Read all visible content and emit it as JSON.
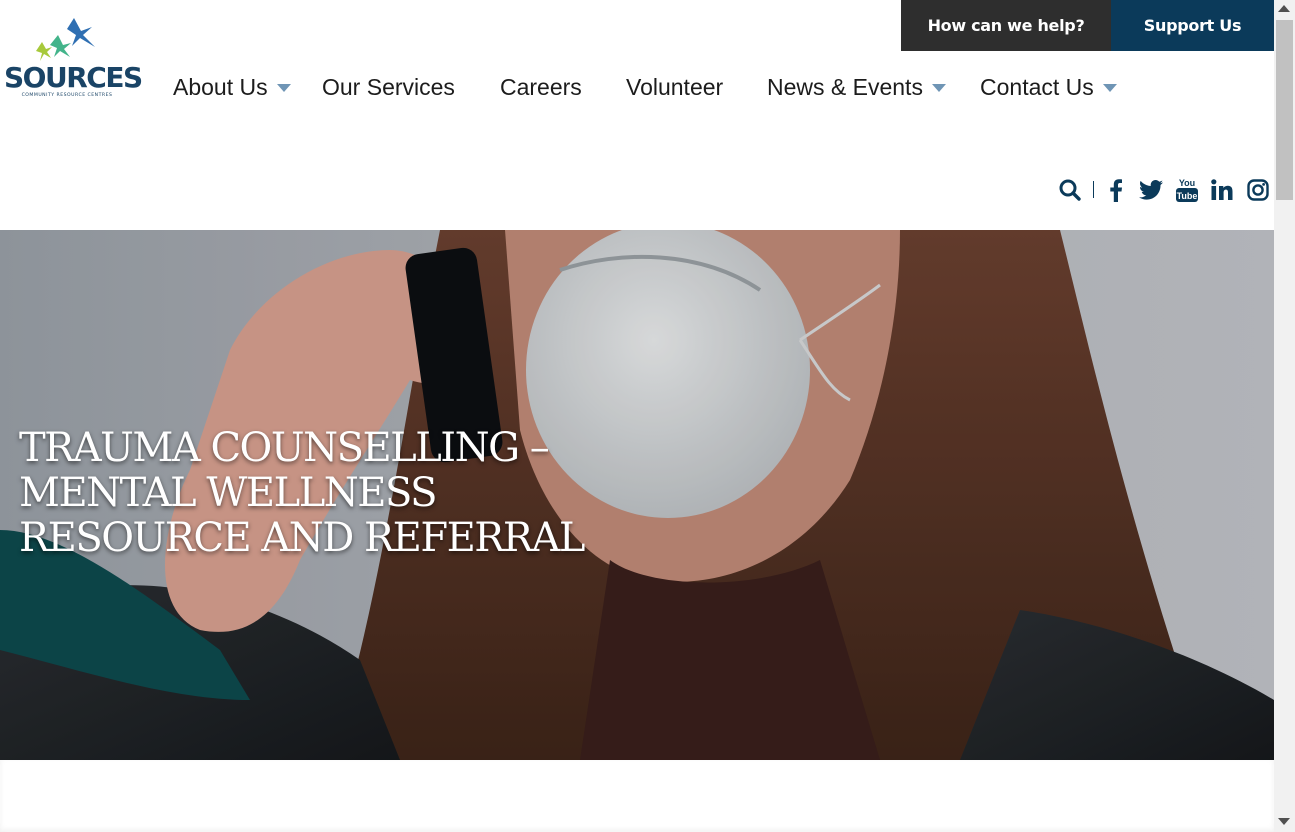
{
  "header": {
    "help_button": "How can we help?",
    "support_button": "Support Us"
  },
  "logo": {
    "wordmark": "SOURCES",
    "tagline": "COMMUNITY RESOURCE CENTRES"
  },
  "nav": {
    "items": [
      {
        "label": "About Us",
        "has_dropdown": true
      },
      {
        "label": "Our Services",
        "has_dropdown": false
      },
      {
        "label": "Careers",
        "has_dropdown": false
      },
      {
        "label": "Volunteer",
        "has_dropdown": false
      },
      {
        "label": "News & Events",
        "has_dropdown": true
      },
      {
        "label": "Contact Us",
        "has_dropdown": true
      }
    ]
  },
  "social_icons": [
    "search-icon",
    "facebook-icon",
    "twitter-icon",
    "youtube-icon",
    "linkedin-icon",
    "instagram-icon"
  ],
  "hero": {
    "title": "TRAUMA COUNSELLING – MENTAL WELLNESS RESOURCE AND REFERRAL",
    "image_subject": "person in face mask on phone"
  },
  "colors": {
    "brand_navy": "#0b3a5a",
    "help_button_bg": "#2e2e2e",
    "nav_caret": "#6f95b5",
    "logo_text": "#1a4466"
  }
}
